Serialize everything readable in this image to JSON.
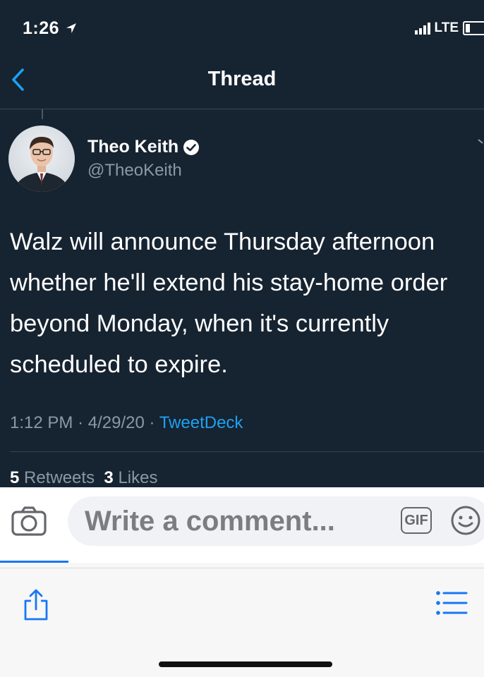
{
  "status_bar": {
    "time": "1:26",
    "network": "LTE",
    "location_icon": "location-arrow-icon",
    "signal_icon": "cellular-signal-icon",
    "battery_icon": "battery-icon"
  },
  "nav": {
    "title": "Thread",
    "back_icon": "chevron-left-icon"
  },
  "tweet": {
    "author": {
      "display_name": "Theo Keith",
      "handle": "@TheoKeith",
      "verified_icon": "verified-badge-icon"
    },
    "text": "Walz will announce Thursday afternoon whether he'll extend his stay-home order beyond Monday, when it's currently scheduled to expire.",
    "time": "1:12 PM",
    "separator": "·",
    "date": "4/29/20",
    "source": "TweetDeck",
    "stats": {
      "retweets_count": "5",
      "retweets_label": "Retweets",
      "likes_count": "3",
      "likes_label": "Likes"
    }
  },
  "comment_bar": {
    "placeholder": "Write a comment...",
    "gif_label": "GIF",
    "camera_icon": "camera-icon",
    "emoji_icon": "emoji-icon"
  },
  "browser_bar": {
    "share_icon": "share-icon",
    "list_icon": "list-icon"
  },
  "colors": {
    "background": "#162331",
    "accent": "#1da1f2",
    "muted_text": "#8b98a5",
    "facebook_blue": "#1877f2"
  }
}
